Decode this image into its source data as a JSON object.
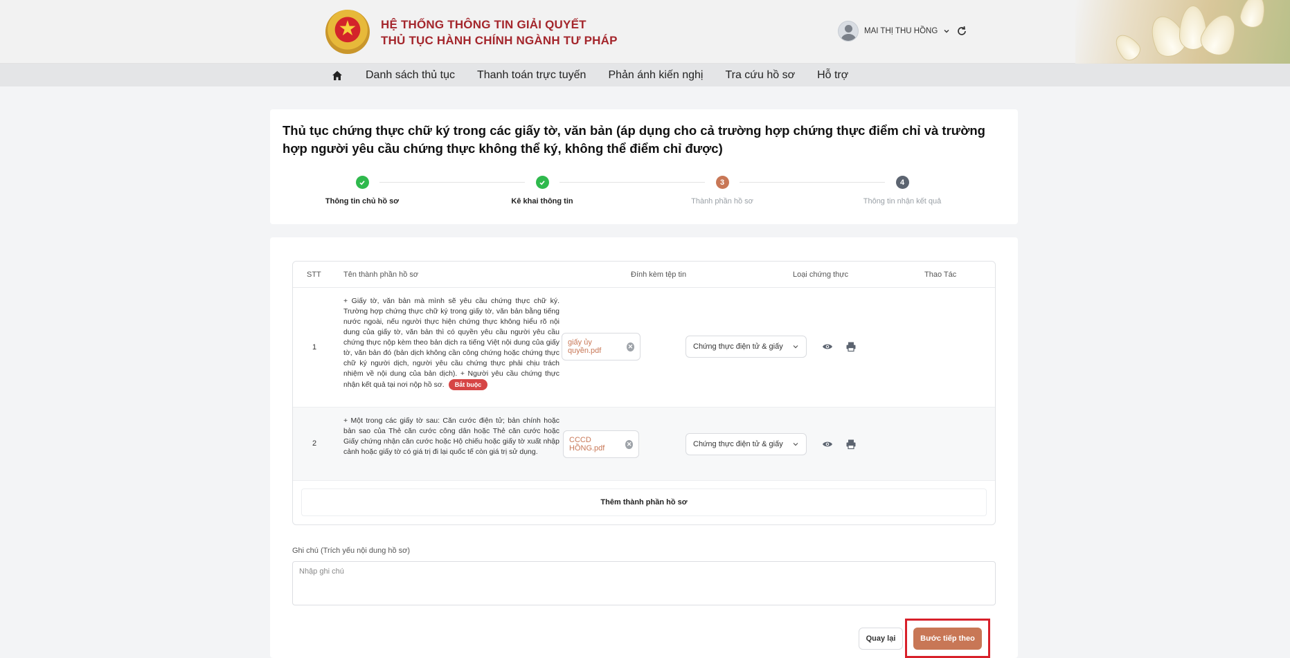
{
  "header": {
    "title_line1": "HỆ THỐNG THÔNG TIN GIẢI QUYẾT",
    "title_line2": "THỦ TỤC HÀNH CHÍNH NGÀNH TƯ PHÁP",
    "user_name": "MAI THỊ THU HỒNG",
    "brand_color": "#a4262c"
  },
  "nav": {
    "items": [
      "Danh sách thủ tục",
      "Thanh toán trực tuyến",
      "Phản ánh kiến nghị",
      "Tra cứu hồ sơ",
      "Hỗ trợ"
    ]
  },
  "procedure": {
    "title": "Thủ tục chứng thực chữ ký trong các giấy tờ, văn bản (áp dụng cho cả trường hợp chứng thực điểm chỉ và trường hợp người yêu cầu chứng thực không thể ký, không thể điểm chỉ được)"
  },
  "steps": [
    {
      "label": "Thông tin chủ hồ sơ",
      "status": "done",
      "number": "1"
    },
    {
      "label": "Kê khai thông tin",
      "status": "done",
      "number": "2"
    },
    {
      "label": "Thành phần hồ sơ",
      "status": "current",
      "number": "3"
    },
    {
      "label": "Thông tin nhận kết quả",
      "status": "pending",
      "number": "4"
    }
  ],
  "table": {
    "headers": {
      "stt": "STT",
      "name": "Tên thành phần hồ sơ",
      "attach": "Đính kèm tệp tin",
      "cert_type": "Loại chứng thực",
      "actions": "Thao Tác"
    },
    "rows": [
      {
        "stt": "1",
        "description": "+ Giấy tờ, văn bản mà mình sẽ yêu cầu chứng thực chữ ký. Trường hợp chứng thực chữ ký trong giấy tờ, văn bản bằng tiếng nước ngoài, nếu người thực hiện chứng thực không hiểu rõ nội dung của giấy tờ, văn bản thì có quyền yêu cầu người yêu cầu chứng thực nộp kèm theo bản dịch ra tiếng Việt nội dung của giấy tờ, văn bản đó (bản dịch không cần công chứng hoặc chứng thực chữ ký người dịch, người yêu cầu chứng thực phải chịu trách nhiệm về nội dung của bản dịch). + Người yêu cầu chứng thực nhận kết quả tại nơi nộp hồ sơ.",
        "badge": "Bắt buộc",
        "file": "giấy ủy quyền.pdf",
        "cert_type": "Chứng thực điện tử & giấy"
      },
      {
        "stt": "2",
        "description": "+ Một trong các giấy tờ sau: Căn cước điện tử; bản chính hoặc bản sao của Thẻ căn cước công dân hoặc Thẻ căn cước hoặc Giấy chứng nhận căn cước hoặc Hộ chiếu hoặc giấy tờ xuất nhập cảnh hoặc giấy tờ có giá trị đi lại quốc tế còn giá trị sử dụng.",
        "file": "CCCD HỒNG.pdf",
        "cert_type": "Chứng thực điện tử & giấy"
      }
    ],
    "add_row_label": "Thêm thành phần hồ sơ"
  },
  "note": {
    "label": "Ghi chú (Trích yếu nội dung hồ sơ)",
    "placeholder": "Nhập ghi chú",
    "value": ""
  },
  "buttons": {
    "back": "Quay lại",
    "next": "Bước tiếp theo"
  },
  "colors": {
    "done": "#2fb94d",
    "current": "#c87756",
    "pending": "#5c6470",
    "accent": "#c87756",
    "highlight_frame": "#d8202a"
  }
}
